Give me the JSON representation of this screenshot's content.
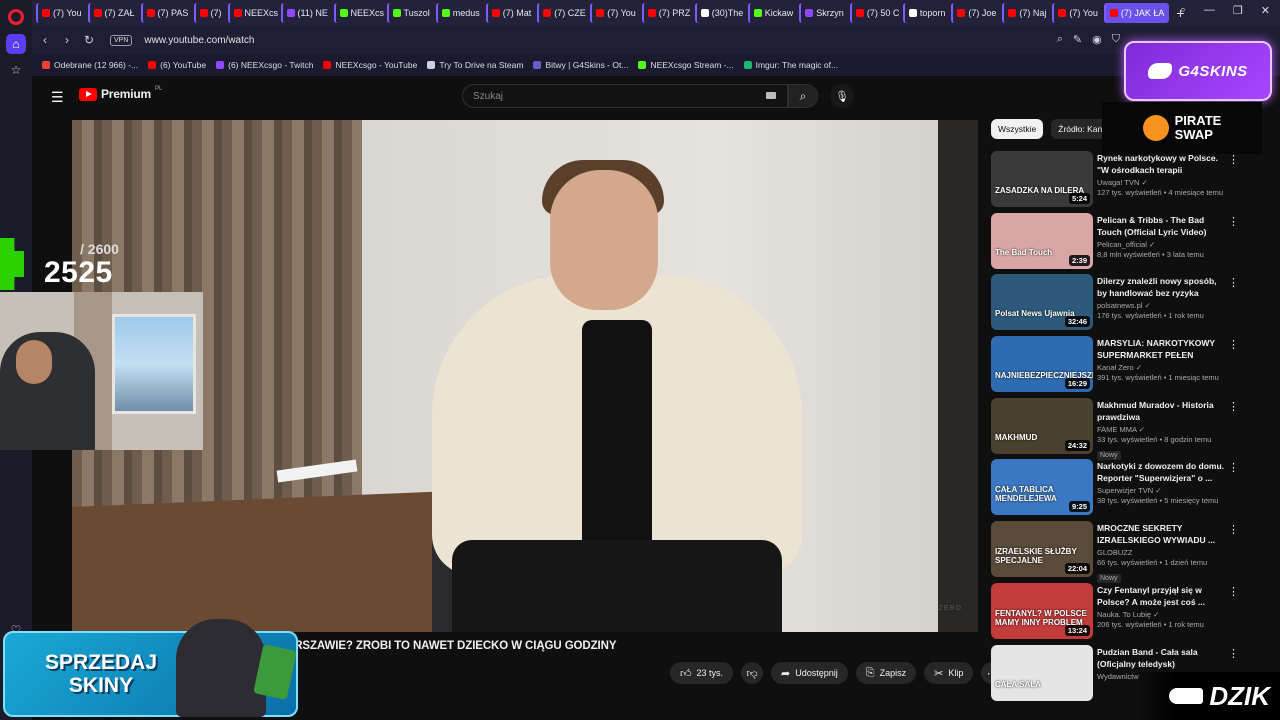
{
  "browser": {
    "tabs": [
      {
        "label": "(7) You",
        "color": "#ff0000"
      },
      {
        "label": "(7) ZAŁ",
        "color": "#ff0000"
      },
      {
        "label": "(7) PAS",
        "color": "#ff0000"
      },
      {
        "label": "(7) ",
        "color": "#ff0000"
      },
      {
        "label": "NEEXcs",
        "color": "#ff0000"
      },
      {
        "label": "(11) NE",
        "color": "#9146ff"
      },
      {
        "label": "NEEXcs",
        "color": "#53fc18"
      },
      {
        "label": "Tuszol",
        "color": "#53fc18"
      },
      {
        "label": "medus",
        "color": "#53fc18"
      },
      {
        "label": "(7) Mat",
        "color": "#ff0000"
      },
      {
        "label": "(7) CZE",
        "color": "#ff0000"
      },
      {
        "label": "(7) You",
        "color": "#ff0000"
      },
      {
        "label": "(7) PRZ",
        "color": "#ff0000"
      },
      {
        "label": "(30)The",
        "color": "#ffffff"
      },
      {
        "label": "Kickaw",
        "color": "#53fc18"
      },
      {
        "label": "Skrzyn",
        "color": "#9146ff"
      },
      {
        "label": "(7) 50 C",
        "color": "#ff0000"
      },
      {
        "label": "toporn",
        "color": "#ffffff"
      },
      {
        "label": "(7) Joe",
        "color": "#ff0000"
      },
      {
        "label": "(7) Naj",
        "color": "#ff0000"
      },
      {
        "label": "(7) You",
        "color": "#ff0000"
      },
      {
        "label": "(7) JAK ŁA",
        "color": "#ff0000",
        "active": true
      }
    ],
    "url": "www.youtube.com/watch",
    "vpn_label": "VPN",
    "bookmarks": [
      {
        "label": "Odebrane (12 966) -...",
        "color": "#ea4335"
      },
      {
        "label": "(6) YouTube",
        "color": "#ff0000"
      },
      {
        "label": "(6) NEEXcsgo - Twitch",
        "color": "#9146ff"
      },
      {
        "label": "NEEXcsgo - YouTube",
        "color": "#ff0000"
      },
      {
        "label": "Try To Drive na Steam",
        "color": "#c6d4df"
      },
      {
        "label": "Bitwy | G4Skins - Ot...",
        "color": "#6a5acd"
      },
      {
        "label": "NEEXcsgo Stream -...",
        "color": "#53fc18"
      },
      {
        "label": "Imgur: The magic of...",
        "color": "#1bb76e"
      }
    ]
  },
  "youtube": {
    "logo_text": "Premium",
    "logo_region": "PL",
    "search_placeholder": "Szukaj",
    "video_title": "ARSZAWIE? ZROBI TO NAWET DZIECKO W CIĄGU GODZINY",
    "watermark": "ZERO",
    "actions": {
      "likes": "23 tys.",
      "share": "Udostępnij",
      "save": "Zapisz",
      "clip": "Klip"
    },
    "chips": [
      "Wszystkie",
      "Źródło: Kana"
    ],
    "recommendations": [
      {
        "title": "Rynek narkotykowy w Polsce. \"W ośrodkach terapii uzależnie...",
        "channel": "Uwaga! TVN ✓",
        "meta": "127 tys. wyświetleń • 4 miesiące temu",
        "duration": "5:24",
        "thumb_text": "ZASADZKA NA DILERA",
        "thumb_color": "#3a3a3a",
        "new": ""
      },
      {
        "title": "Pelican & Tribbs - The Bad Touch (Official Lyric Video)",
        "channel": "Pelican_official ✓",
        "meta": "8,8 mln wyświetleń • 3 lata temu",
        "duration": "2:39",
        "thumb_text": "The Bad Touch",
        "thumb_color": "#d9a6a6",
        "new": ""
      },
      {
        "title": "Dilerzy znaleźli nowy sposób, by handlować bez ryzyka",
        "channel": "polsatnews.pl ✓",
        "meta": "176 tys. wyświetleń • 1 rok temu",
        "duration": "32:46",
        "thumb_text": "Polsat News Ujawnia",
        "thumb_color": "#2d5a7a",
        "new": ""
      },
      {
        "title": "MARSYLIA: NARKOTYKOWY SUPERMARKET PEŁEN BRUD...",
        "channel": "Kanał Zero ✓",
        "meta": "391 tys. wyświetleń • 1 miesiąc temu",
        "duration": "16:29",
        "thumb_text": "NAJNIEBEZPIECZNIEJSZE",
        "thumb_color": "#2f6bb0",
        "new": ""
      },
      {
        "title": "Makhmud Muradov - Historia prawdziwa",
        "channel": "FAME MMA ✓",
        "meta": "33 tys. wyświetleń • 8 godzin temu",
        "duration": "24:32",
        "thumb_text": "MAKHMUD",
        "thumb_color": "#4a4030",
        "new": "Nowy"
      },
      {
        "title": "Narkotyki z dowozem do domu. Reporter \"Superwizjera\" o ...",
        "channel": "Superwizjer TVN ✓",
        "meta": "38 tys. wyświetleń • 5 miesięcy temu",
        "duration": "9:25",
        "thumb_text": "CAŁA TABLICA MENDELEJEWA",
        "thumb_color": "#3b78c4",
        "new": ""
      },
      {
        "title": "MROCZNE SEKRETY IZRAELSKIEGO WYWIADU ...",
        "channel": "GLOBUZZ",
        "meta": "66 tys. wyświetleń • 1 dzień temu",
        "duration": "22:04",
        "thumb_text": "IZRAELSKIE SŁUŻBY SPECJALNE",
        "thumb_color": "#5a4a3a",
        "new": "Nowy"
      },
      {
        "title": "Czy Fentanyl przyjął się w Polsce? A może jest coś ...",
        "channel": "Nauka. To Lubię ✓",
        "meta": "206 tys. wyświetleń • 1 rok temu",
        "duration": "13:24",
        "thumb_text": "FENTANYL? W POLSCE MAMY INNY PROBLEM",
        "thumb_color": "#c33b3b",
        "new": ""
      },
      {
        "title": "Pudzian Band - Cała sala (Oficjalny teledysk)",
        "channel": "Wydawnictw",
        "meta": "",
        "duration": "",
        "thumb_text": "CAŁA SALA",
        "thumb_color": "#e5e5e5",
        "new": ""
      }
    ]
  },
  "overlays": {
    "counter_max": "/ 2600",
    "counter_value": "2525",
    "g4skins": "G4SKINS",
    "pirateswap_line1": "PIRATE",
    "pirateswap_line2": "SWAP",
    "sprzedaj_line1": "SPRZEDAJ",
    "sprzedaj_line2": "SKINY",
    "dzik": "DZIK"
  }
}
